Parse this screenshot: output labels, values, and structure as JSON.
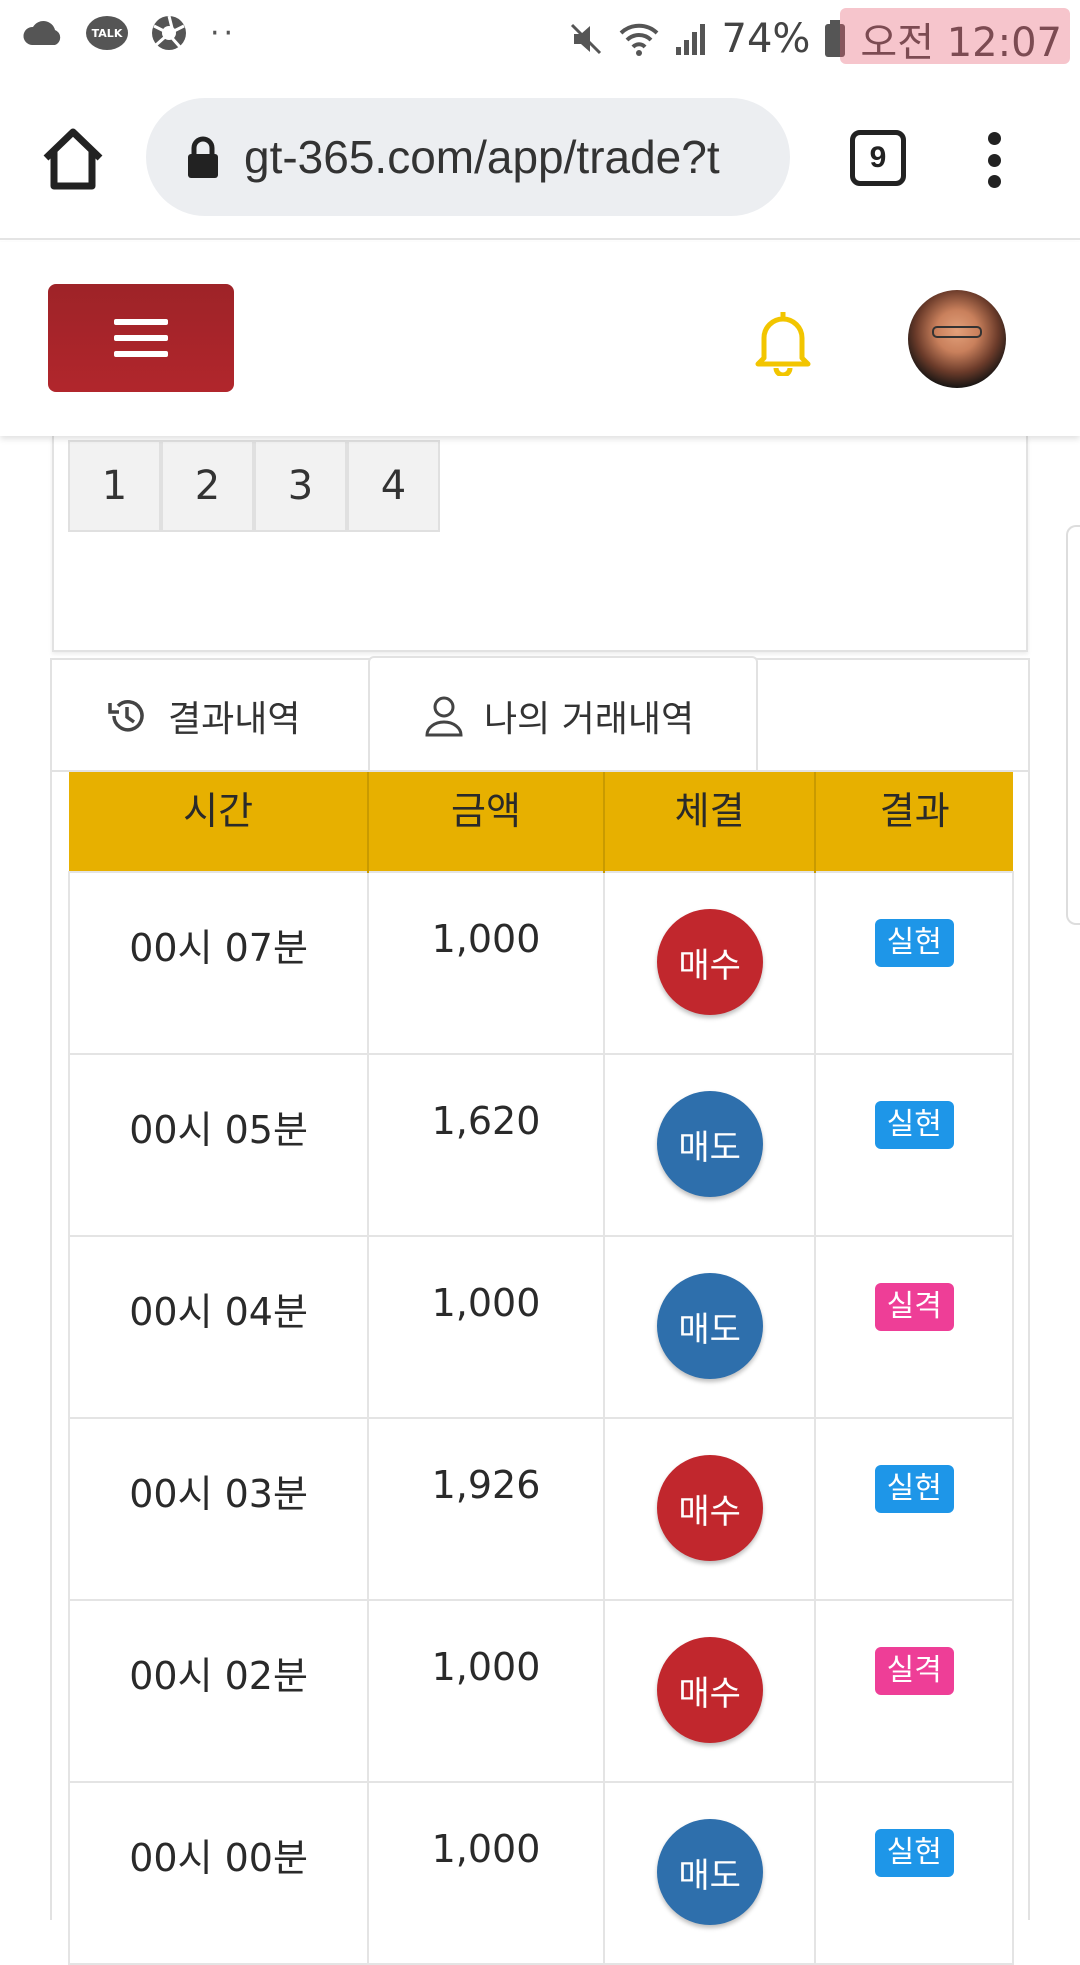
{
  "status_bar": {
    "kakao_label": "TALK",
    "battery": "74%",
    "time": "오전 12:07",
    "dots": "··"
  },
  "browser": {
    "url": "gt-365.com/app/trade?t",
    "tab_count": "9"
  },
  "pagination": [
    "1",
    "2",
    "3",
    "4"
  ],
  "tabs": {
    "results": "결과내역",
    "my_trades": "나의 거래내역"
  },
  "table": {
    "headers": [
      "시간",
      "금액",
      "체결",
      "결과"
    ],
    "rows": [
      {
        "time": "00시 07분",
        "amount": "1,000",
        "trade": "매수",
        "result": "실현"
      },
      {
        "time": "00시 05분",
        "amount": "1,620",
        "trade": "매도",
        "result": "실현"
      },
      {
        "time": "00시 04분",
        "amount": "1,000",
        "trade": "매도",
        "result": "실격"
      },
      {
        "time": "00시 03분",
        "amount": "1,926",
        "trade": "매수",
        "result": "실현"
      },
      {
        "time": "00시 02분",
        "amount": "1,000",
        "trade": "매수",
        "result": "실격"
      },
      {
        "time": "00시 00분",
        "amount": "1,000",
        "trade": "매도",
        "result": "실현"
      }
    ]
  },
  "colors": {
    "menu_button": "#b1262c",
    "header_gold": "#e7b000",
    "buy": "#c1272d",
    "sell": "#2e6fac",
    "result_win": "#1e96e8",
    "result_lose": "#ee3e97",
    "bell": "#f2c500"
  },
  "icons": [
    "cloud-icon",
    "kakaotalk-icon",
    "aperture-icon",
    "mute-icon",
    "wifi-icon",
    "signal-icon",
    "battery-icon",
    "home-icon",
    "lock-icon",
    "tabs-icon",
    "more-vert-icon",
    "menu-icon",
    "bell-icon",
    "history-icon",
    "user-icon"
  ]
}
